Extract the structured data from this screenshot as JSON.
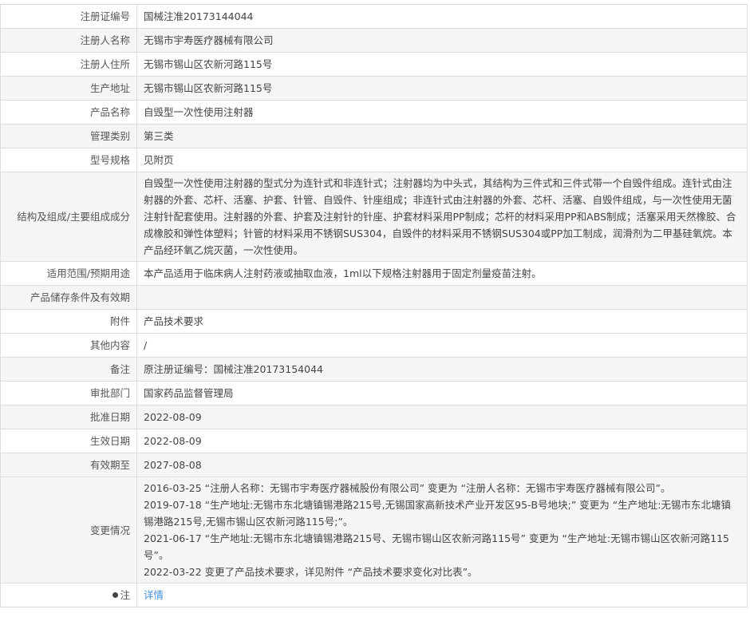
{
  "rows": [
    {
      "label": "注册证编号",
      "value": "国械注准20173144044"
    },
    {
      "label": "注册人名称",
      "value": "无锡市宇寿医疗器械有限公司"
    },
    {
      "label": "注册人住所",
      "value": "无锡市锡山区农新河路115号"
    },
    {
      "label": "生产地址",
      "value": "无锡市锡山区农新河路115号"
    },
    {
      "label": "产品名称",
      "value": "自毁型一次性使用注射器"
    },
    {
      "label": "管理类别",
      "value": "第三类"
    },
    {
      "label": "型号规格",
      "value": "见附页"
    },
    {
      "label": "结构及组成/主要组成成分",
      "value": "自毁型一次性使用注射器的型式分为连针式和非连针式；注射器均为中头式，其结构为三件式和三件式带一个自毁件组成。连针式由注射器的外套、芯杆、活塞、护套、针管、自毁件、针座组成；非连针式由注射器的外套、芯杆、活塞、自毁件组成，与一次性使用无菌注射针配套使用。注射器的外套、护套及注射针的针座、护套材料采用PP制成；芯杆的材料采用PP和ABS制成；活塞采用天然橡胶、合成橡胶和弹性体塑料；针管的材料采用不锈钢SUS304，自毁件的材料采用不锈钢SUS304或PP加工制成，润滑剂为二甲基硅氧烷。本产品经环氧乙烷灭菌，一次性使用。"
    },
    {
      "label": "适用范围/预期用途",
      "value": "本产品适用于临床病人注射药液或抽取血液，1ml以下规格注射器用于固定剂量疫苗注射。"
    },
    {
      "label": "产品储存条件及有效期",
      "value": ""
    },
    {
      "label": "附件",
      "value": "产品技术要求"
    },
    {
      "label": "其他内容",
      "value": "/"
    },
    {
      "label": "备注",
      "value": "原注册证编号：国械注准20173154044"
    },
    {
      "label": "审批部门",
      "value": "国家药品监督管理局"
    },
    {
      "label": "批准日期",
      "value": "2022-08-09"
    },
    {
      "label": "生效日期",
      "value": "2022-08-09"
    },
    {
      "label": "有效期至",
      "value": "2027-08-08"
    }
  ],
  "changes": {
    "label": "变更情况",
    "entries": [
      "2016-03-25 “注册人名称：无锡市宇寿医疗器械股份有限公司” 变更为 “注册人名称：无锡市宇寿医疗器械有限公司”。",
      "2019-07-18 “生产地址:无锡市东北塘镇锡港路215号,无锡国家高新技术产业开发区95-B号地块;” 变更为 “生产地址:无锡市东北塘镇锡港路215号,无锡市锡山区农新河路115号;”。",
      "2021-06-17 “生产地址:无锡市东北塘镇锡港路215号、无锡市锡山区农新河路115号” 变更为 “生产地址:无锡市锡山区农新河路115号”。",
      "2022-03-22 变更了产品技术要求，详见附件 “产品技术要求变化对比表”。"
    ]
  },
  "note": {
    "label": "注",
    "icon": "pin-icon",
    "link": "详情"
  }
}
